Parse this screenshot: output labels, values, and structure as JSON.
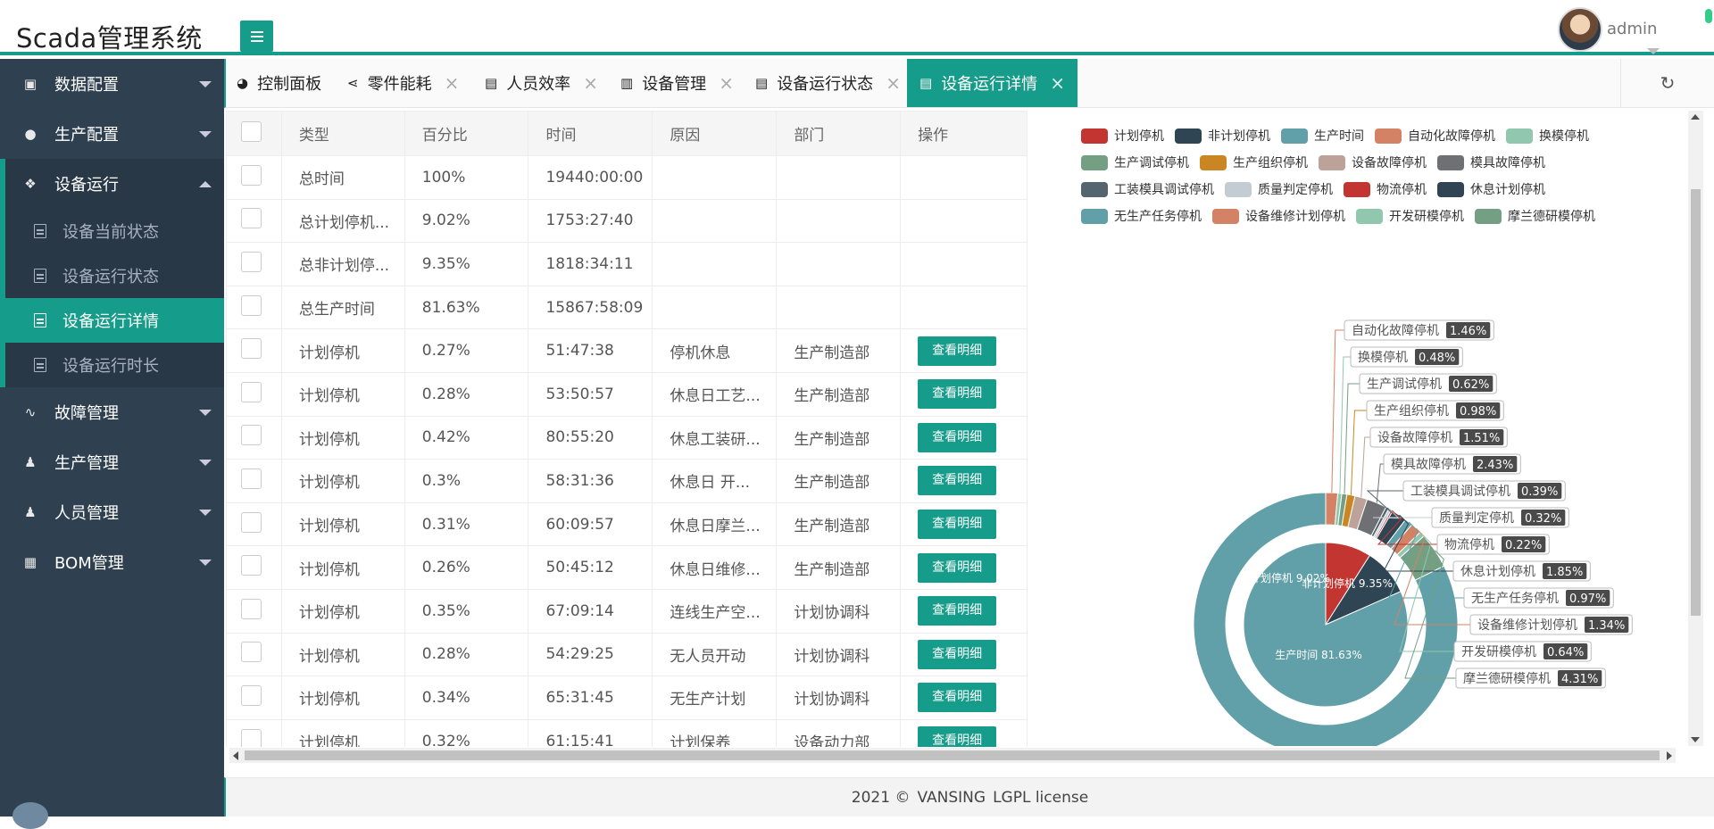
{
  "app": {
    "title": "Scada管理系统",
    "user": "admin"
  },
  "colors": {
    "accent": "#169c8a",
    "sidebar": "#2f4050"
  },
  "sidebar": {
    "groups": [
      {
        "label": "数据配置",
        "icon": "image-icon"
      },
      {
        "label": "生产配置",
        "icon": "comment-icon"
      },
      {
        "label": "设备运行",
        "icon": "cubes-icon",
        "open": true,
        "items": [
          {
            "label": "设备当前状态"
          },
          {
            "label": "设备运行状态"
          },
          {
            "label": "设备运行详情",
            "active": true
          },
          {
            "label": "设备运行时长"
          }
        ]
      },
      {
        "label": "故障管理",
        "icon": "pulse-icon"
      },
      {
        "label": "生产管理",
        "icon": "user-icon"
      },
      {
        "label": "人员管理",
        "icon": "user-icon"
      },
      {
        "label": "BOM管理",
        "icon": "table-icon"
      }
    ]
  },
  "tabs": [
    {
      "label": "控制面板",
      "icon": "dashboard-icon",
      "closable": false
    },
    {
      "label": "零件能耗",
      "icon": "share-icon",
      "closable": true
    },
    {
      "label": "人员效率",
      "icon": "clipboard-icon",
      "closable": true
    },
    {
      "label": "设备管理",
      "icon": "trash-icon",
      "closable": true
    },
    {
      "label": "设备运行状态",
      "icon": "clipboard-icon",
      "closable": true
    },
    {
      "label": "设备运行详情",
      "icon": "clipboard-icon",
      "closable": true,
      "active": true
    }
  ],
  "table": {
    "columns": [
      "",
      "类型",
      "百分比",
      "时间",
      "原因",
      "部门",
      "操作"
    ],
    "action_label": "查看明细",
    "rows": [
      {
        "type": "总时间",
        "percent": "100%",
        "time": "19440:00:00",
        "reason": "",
        "dept": "",
        "action": false
      },
      {
        "type": "总计划停机...",
        "percent": "9.02%",
        "time": "1753:27:40",
        "reason": "",
        "dept": "",
        "action": false
      },
      {
        "type": "总非计划停...",
        "percent": "9.35%",
        "time": "1818:34:11",
        "reason": "",
        "dept": "",
        "action": false
      },
      {
        "type": "总生产时间",
        "percent": "81.63%",
        "time": "15867:58:09",
        "reason": "",
        "dept": "",
        "action": false
      },
      {
        "type": "计划停机",
        "percent": "0.27%",
        "time": "51:47:38",
        "reason": "停机休息",
        "dept": "生产制造部",
        "action": true
      },
      {
        "type": "计划停机",
        "percent": "0.28%",
        "time": "53:50:57",
        "reason": "休息日工艺...",
        "dept": "生产制造部",
        "action": true
      },
      {
        "type": "计划停机",
        "percent": "0.42%",
        "time": "80:55:20",
        "reason": "休息工装研...",
        "dept": "生产制造部",
        "action": true
      },
      {
        "type": "计划停机",
        "percent": "0.3%",
        "time": "58:31:36",
        "reason": "休息日 开...",
        "dept": "生产制造部",
        "action": true
      },
      {
        "type": "计划停机",
        "percent": "0.31%",
        "time": "60:09:57",
        "reason": "休息日摩兰...",
        "dept": "生产制造部",
        "action": true
      },
      {
        "type": "计划停机",
        "percent": "0.26%",
        "time": "50:45:12",
        "reason": "休息日维修...",
        "dept": "生产制造部",
        "action": true
      },
      {
        "type": "计划停机",
        "percent": "0.35%",
        "time": "67:09:14",
        "reason": "连线生产空...",
        "dept": "计划协调科",
        "action": true
      },
      {
        "type": "计划停机",
        "percent": "0.28%",
        "time": "54:29:25",
        "reason": "无人员开动",
        "dept": "计划协调科",
        "action": true
      },
      {
        "type": "计划停机",
        "percent": "0.34%",
        "time": "65:31:45",
        "reason": "无生产计划",
        "dept": "计划协调科",
        "action": true
      },
      {
        "type": "计划停机",
        "percent": "0.32%",
        "time": "61:15:41",
        "reason": "计划保养",
        "dept": "设备动力部",
        "action": true
      }
    ]
  },
  "chart_data": {
    "type": "pie",
    "legend": [
      {
        "name": "计划停机",
        "color": "#c23531"
      },
      {
        "name": "非计划停机",
        "color": "#2f4554"
      },
      {
        "name": "生产时间",
        "color": "#61a0a8"
      },
      {
        "name": "自动化故障停机",
        "color": "#d48265"
      },
      {
        "name": "换模停机",
        "color": "#91c7ae"
      },
      {
        "name": "生产调试停机",
        "color": "#749f83"
      },
      {
        "name": "生产组织停机",
        "color": "#ca8622"
      },
      {
        "name": "设备故障停机",
        "color": "#bda29a"
      },
      {
        "name": "模具故障停机",
        "color": "#6e7074"
      },
      {
        "name": "工装模具调试停机",
        "color": "#546570"
      },
      {
        "name": "质量判定停机",
        "color": "#c4ccd3"
      },
      {
        "name": "物流停机",
        "color": "#c23531"
      },
      {
        "name": "休息计划停机",
        "color": "#2f4554"
      },
      {
        "name": "无生产任务停机",
        "color": "#61a0a8"
      },
      {
        "name": "设备维修计划停机",
        "color": "#d48265"
      },
      {
        "name": "开发研模停机",
        "color": "#91c7ae"
      },
      {
        "name": "摩兰德研模停机",
        "color": "#749f83"
      }
    ],
    "inner_series": [
      {
        "name": "计划停机",
        "value": 9.02,
        "label": "计划停机 9.02%",
        "color": "#c23531"
      },
      {
        "name": "非计划停机",
        "value": 9.35,
        "label": "非计划停机 9.35%",
        "color": "#2f4554"
      },
      {
        "name": "生产时间",
        "value": 81.63,
        "label": "生产时间 81.63%",
        "color": "#61a0a8"
      }
    ],
    "outer_series": [
      {
        "name": "自动化故障停机",
        "value": 1.46,
        "label": "1.46%",
        "color": "#d48265"
      },
      {
        "name": "换模停机",
        "value": 0.48,
        "label": "0.48%",
        "color": "#91c7ae"
      },
      {
        "name": "生产调试停机",
        "value": 0.62,
        "label": "0.62%",
        "color": "#749f83"
      },
      {
        "name": "生产组织停机",
        "value": 0.98,
        "label": "0.98%",
        "color": "#ca8622"
      },
      {
        "name": "设备故障停机",
        "value": 1.51,
        "label": "1.51%",
        "color": "#bda29a"
      },
      {
        "name": "模具故障停机",
        "value": 2.43,
        "label": "2.43%",
        "color": "#6e7074"
      },
      {
        "name": "工装模具调试停机",
        "value": 0.39,
        "label": "0.39%",
        "color": "#546570"
      },
      {
        "name": "质量判定停机",
        "value": 0.32,
        "label": "0.32%",
        "color": "#c4ccd3"
      },
      {
        "name": "物流停机",
        "value": 0.22,
        "label": "0.22%",
        "color": "#c23531"
      },
      {
        "name": "休息计划停机",
        "value": 1.85,
        "label": "1.85%",
        "color": "#2f4554"
      },
      {
        "name": "无生产任务停机",
        "value": 0.97,
        "label": "0.97%",
        "color": "#61a0a8"
      },
      {
        "name": "设备维修计划停机",
        "value": 1.34,
        "label": "1.34%",
        "color": "#d48265"
      },
      {
        "name": "开发研模停机",
        "value": 0.64,
        "label": "0.64%",
        "color": "#91c7ae"
      },
      {
        "name": "摩兰德研模停机",
        "value": 4.31,
        "label": "4.31%",
        "color": "#749f83"
      },
      {
        "name": "生产时间",
        "value": 81.63,
        "label": "",
        "color": "#61a0a8"
      }
    ]
  },
  "footer": {
    "year": "2021 ©",
    "company": "VANSING",
    "license": "LGPL license"
  }
}
